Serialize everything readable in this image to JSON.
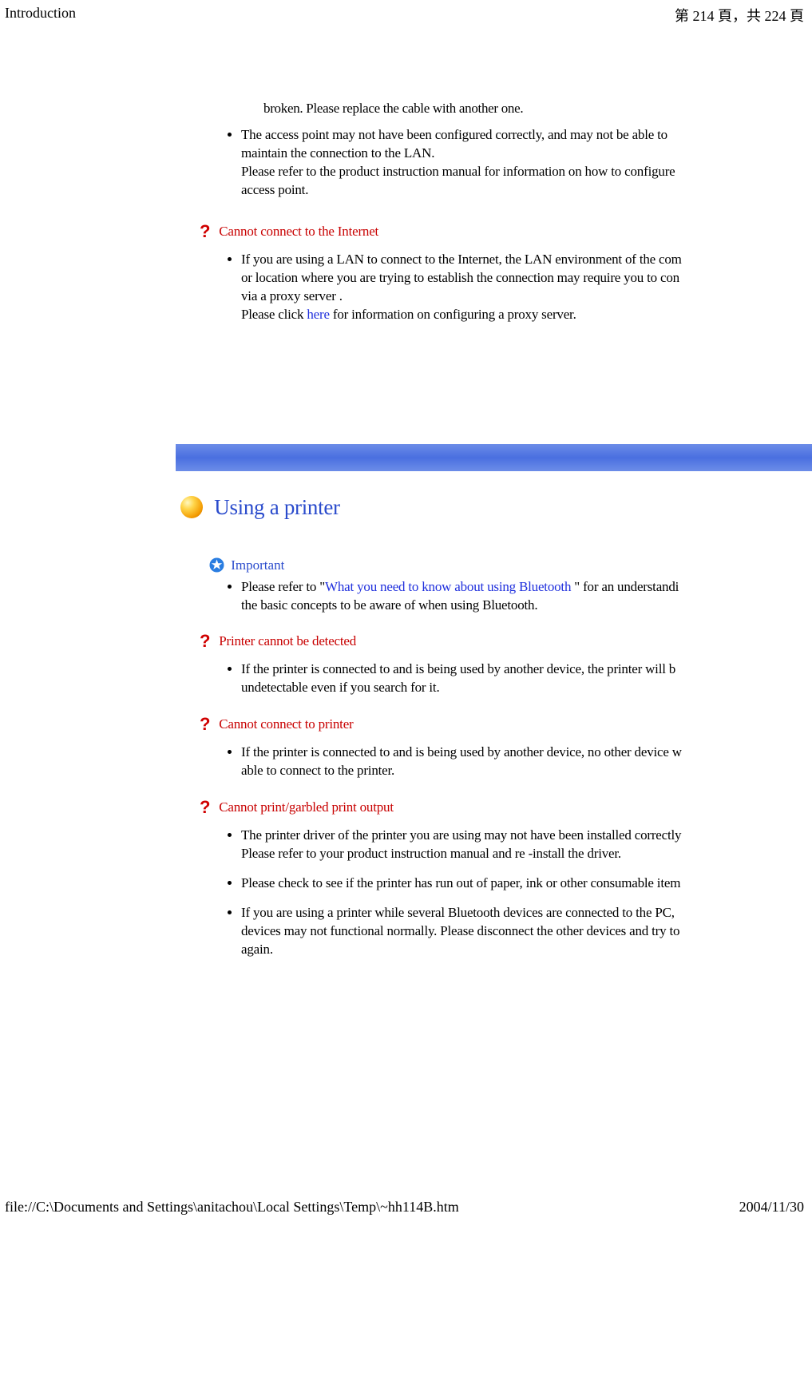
{
  "header": {
    "title": "Introduction",
    "page_info": "第 214 頁，共 224 頁"
  },
  "top_partial": "broken. Please replace the cable with another one.",
  "lan_item": {
    "l1": "The access point may not have been configured correctly, and may not be able to",
    "l2": "maintain the connection to the LAN.",
    "l3": "Please refer to the product instruction manual for information on how to configure",
    "l4": "access point."
  },
  "q_internet": "Cannot connect to the Internet",
  "internet_item": {
    "l1": "If you are using a LAN to connect to the Internet, the LAN environment of the com",
    "l2": "or location where you are trying to establish the connection may require you to con",
    "l3": "via a proxy server .",
    "l4a": "Please click ",
    "link": "here",
    "l4b": " for information on configuring a proxy server."
  },
  "section_title": "Using a printer",
  "important_label": "Important",
  "important_item": {
    "l1a": "Please refer to \"",
    "link": "What you need to know about using Bluetooth",
    "l1b": " \" for an understandi",
    "l2": "the basic concepts to be aware of when using Bluetooth."
  },
  "q_printer_detect": "Printer cannot be detected",
  "printer_detect_item": {
    "l1": "If the printer is connected to and is being used by another device, the printer will b",
    "l2": "undetectable even if you search for it."
  },
  "q_printer_connect": "Cannot connect to printer",
  "printer_connect_item": {
    "l1": "If the printer is connected to and is being used by another device, no other device w",
    "l2": "able to connect to the printer."
  },
  "q_print_garbled": "Cannot print/garbled print output",
  "garbled_items": {
    "a1": "The printer driver of the printer you are using may not have been installed correctly",
    "a2": "Please refer to your product instruction manual and re -install the driver.",
    "b": "Please check to see if the printer has run out of paper, ink or other consumable item",
    "c1": "If you are using a printer while several Bluetooth devices are connected to the PC,",
    "c2": "devices may not functional normally. Please disconnect the other devices and try to",
    "c3": "again."
  },
  "footer": {
    "path": "file://C:\\Documents and Settings\\anitachou\\Local Settings\\Temp\\~hh114B.htm",
    "date": "2004/11/30"
  }
}
